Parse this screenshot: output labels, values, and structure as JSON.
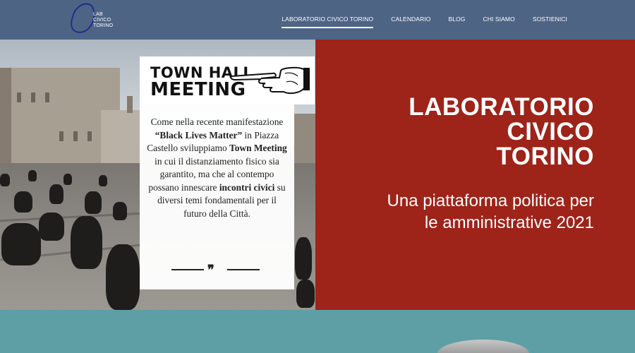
{
  "logo": {
    "lines": [
      "LAB",
      "CIVICO",
      "TORINO"
    ]
  },
  "nav": {
    "items": [
      {
        "label": "LABORATORIO CIVICO TORINO",
        "active": true
      },
      {
        "label": "CALENDARIO",
        "active": false
      },
      {
        "label": "BLOG",
        "active": false
      },
      {
        "label": "CHI SIAMO",
        "active": false
      },
      {
        "label": "SOSTIENICI",
        "active": false
      }
    ]
  },
  "card": {
    "title_line1": "TOWN HALL",
    "title_line2": "MEETING",
    "text": {
      "p1": "Come nella recente manifestazione ",
      "b1": "“Black Lives Matter”",
      "p2": " in Piazza Castello sviluppiamo ",
      "b2": "Town Meeting",
      "p3": " in cui il distanziamento fisico sia garantito, ma che al contempo possano innescare ",
      "b3": "incontri civici",
      "p4": " su diversi temi fondamentali per il futuro della Città."
    },
    "quote_mark": "❞"
  },
  "hero": {
    "title_lines": [
      "LABORATORIO",
      "CIVICO",
      "TORINO"
    ],
    "subtitle_lines": [
      "Una piattaforma politica per",
      "le amministrative 2021"
    ]
  },
  "colors": {
    "header": "#4e6485",
    "red_panel": "#9e2319",
    "teal_band": "#5e9fa6"
  }
}
